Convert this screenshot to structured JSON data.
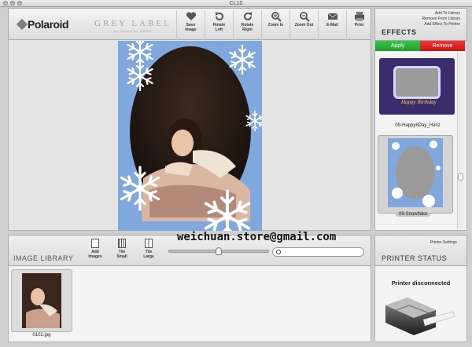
{
  "window": {
    "title": "CL10"
  },
  "toolbar": {
    "logo": "Polaroid",
    "grey_label": "GREY LABEL",
    "by_line": "by HAUS of GAGA",
    "buttons": [
      {
        "id": "save",
        "label_1": "Save",
        "label_2": "Image",
        "icon": "heart-icon"
      },
      {
        "id": "rotate-left",
        "label_1": "Rotate",
        "label_2": "Left",
        "icon": "rotate-left-icon"
      },
      {
        "id": "rotate-right",
        "label_1": "Rotate",
        "label_2": "Right",
        "icon": "rotate-right-icon"
      },
      {
        "id": "zoom-in",
        "label_1": "Zoom In",
        "label_2": "",
        "icon": "zoom-in-icon"
      },
      {
        "id": "zoom-out",
        "label_1": "Zoom Out",
        "label_2": "",
        "icon": "zoom-out-icon"
      },
      {
        "id": "email",
        "label_1": "E-Mail",
        "label_2": "",
        "icon": "email-icon"
      },
      {
        "id": "print",
        "label_1": "Print",
        "label_2": "",
        "icon": "printer-icon"
      }
    ]
  },
  "image_library": {
    "title": "IMAGE LIBRARY",
    "add_images_1": "Add",
    "add_images_2": "Images",
    "tile_small_1": "Tile",
    "tile_small_2": "Small",
    "tile_large_1": "Tile",
    "tile_large_2": "Large",
    "slider_level": 0.5,
    "items": [
      {
        "filename": "0102.jpg"
      }
    ]
  },
  "watermark": "weichuan.store@gmail.com",
  "effects": {
    "title": "EFFECTS",
    "links": [
      "Add To Library",
      "Remove From Library",
      "Add Effect To Printer"
    ],
    "apply_label": "Apply",
    "remove_label": "Remove",
    "items": [
      {
        "name": "09-Happy8Day_Horiz",
        "text": "Happy Birthday"
      },
      {
        "name": "09-Snowflake",
        "selected": true
      }
    ],
    "colors": {
      "apply": "#27b037",
      "remove": "#e02020",
      "snow_bg": "#80a8dc"
    }
  },
  "printer": {
    "settings_label": "Printer Settings",
    "title": "PRINTER STATUS",
    "status": "Printer disconnected"
  }
}
